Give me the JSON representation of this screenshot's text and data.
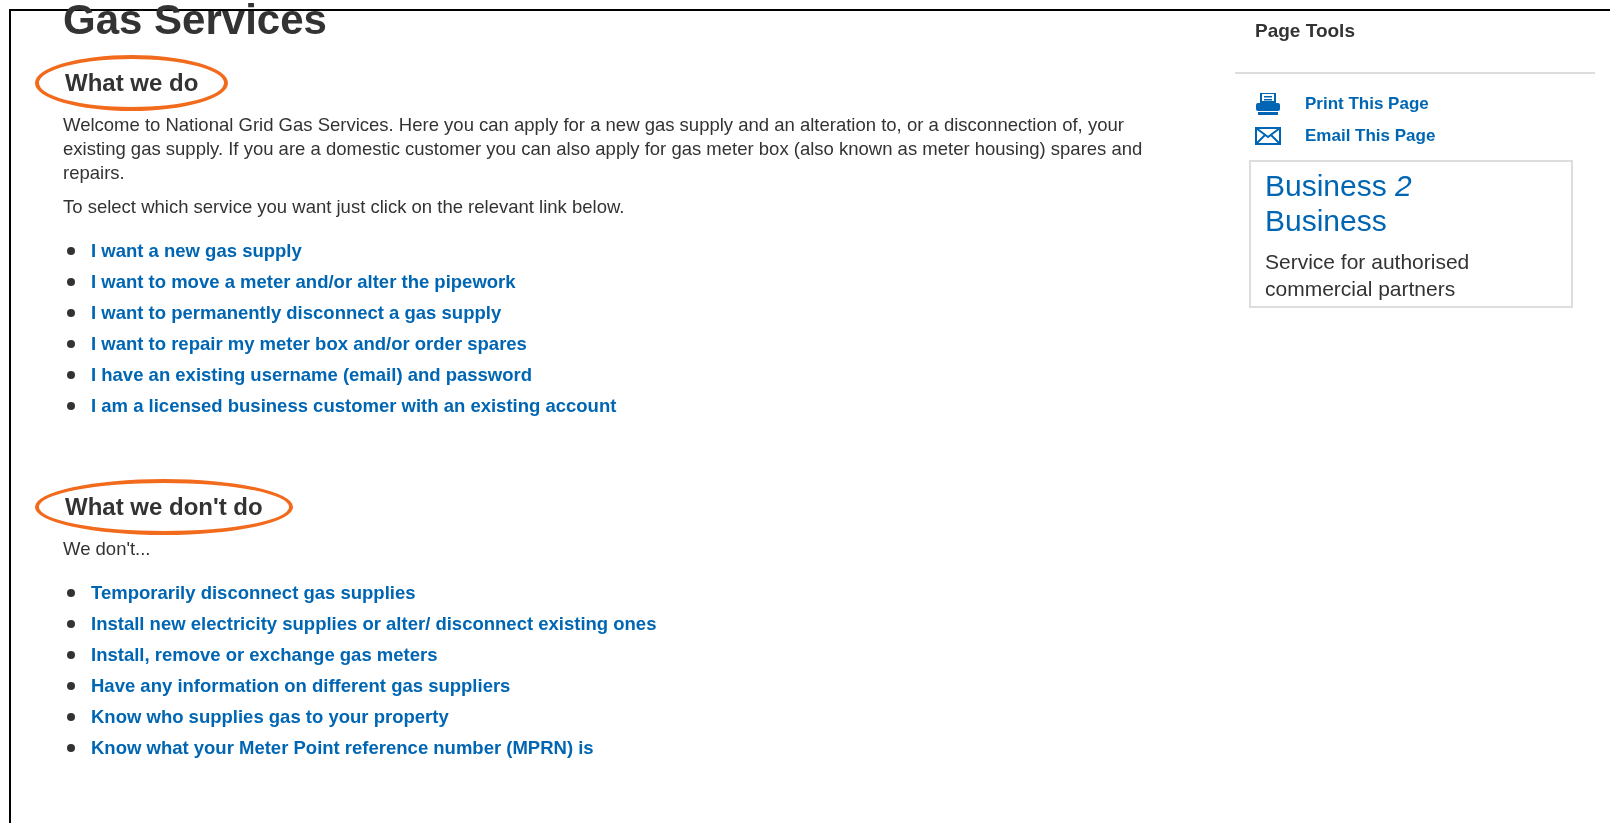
{
  "page_title": "Gas Services",
  "sections": [
    {
      "heading": "What we do",
      "highlighted": true,
      "paragraphs": [
        "Welcome to National Grid Gas Services. Here you can apply for a new gas supply and an alteration to, or a disconnection of, your existing gas supply. If you are a domestic customer you can also apply for gas meter box (also known as meter housing) spares and repairs.",
        "To select which service you want just click on the relevant link below."
      ],
      "links": [
        "I want a new gas supply",
        "I want to move a meter and/or alter the pipework",
        "I want to permanently disconnect a gas supply",
        "I want to repair my meter box and/or order spares",
        "I have an existing username (email) and password",
        "I am a licensed business customer with an existing account"
      ]
    },
    {
      "heading": "What we don't do",
      "highlighted": true,
      "paragraphs": [
        "We don't..."
      ],
      "links": [
        "Temporarily disconnect gas supplies",
        "Install new electricity supplies or alter/ disconnect existing ones",
        "Install, remove or exchange gas meters",
        "Have any information on different gas suppliers",
        "Know who supplies gas to your property",
        "Know what your Meter Point reference number (MPRN) is"
      ]
    }
  ],
  "page_tools": {
    "title": "Page Tools",
    "tools": [
      {
        "kind": "print",
        "label": "Print This Page"
      },
      {
        "kind": "email",
        "label": "Email This Page"
      }
    ]
  },
  "promo": {
    "title_start": "Business",
    "title_number": "2",
    "title_end": "Business",
    "text": "Service for authorised commercial partners"
  }
}
